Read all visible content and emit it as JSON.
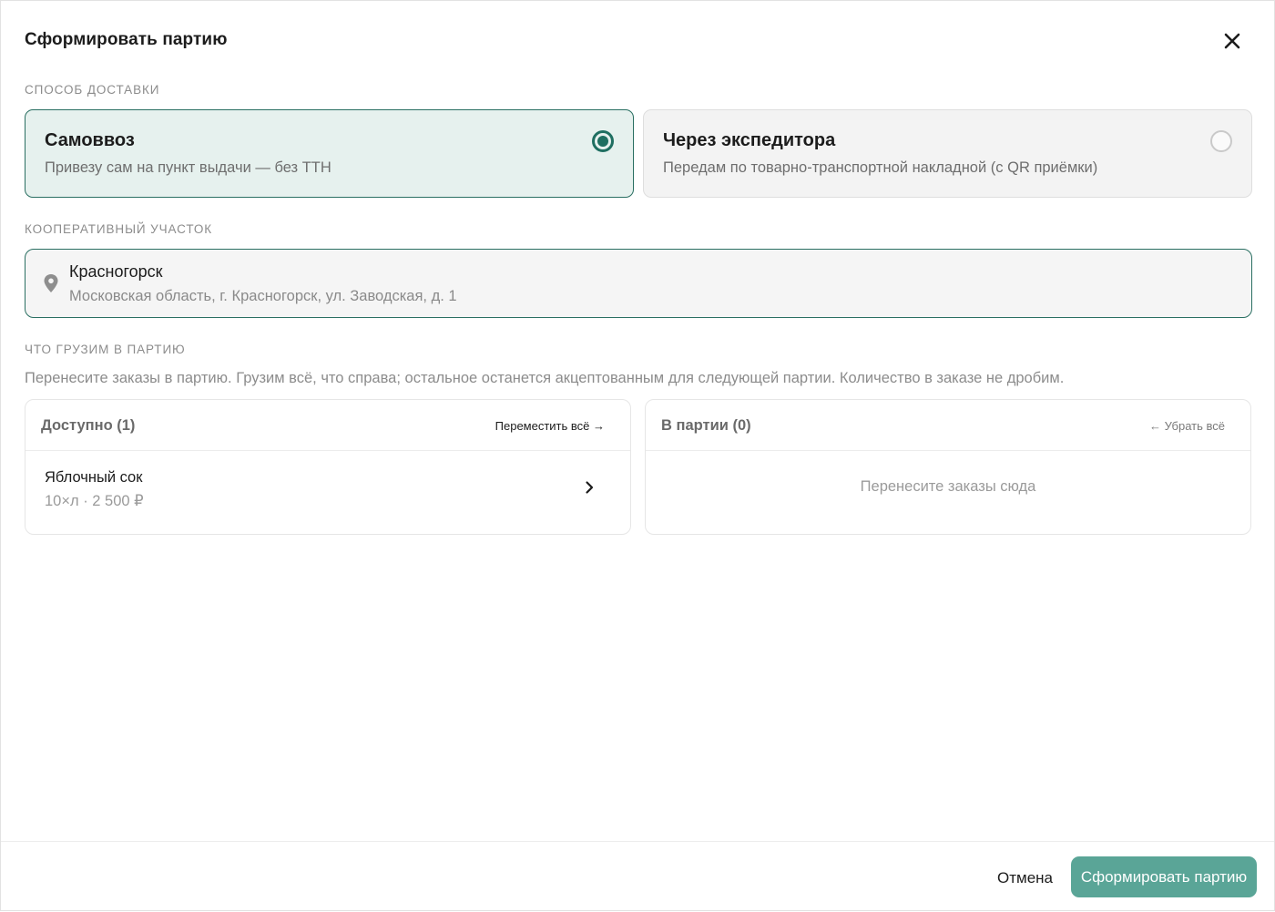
{
  "dialog": {
    "title": "Сформировать партию",
    "close_icon": "close-icon"
  },
  "delivery": {
    "label": "СПОСОБ ДОСТАВКИ",
    "options": [
      {
        "title": "Самоввоз",
        "description": "Привезу сам на пункт выдачи — без ТТН",
        "selected": true
      },
      {
        "title": "Через экспедитора",
        "description": "Передам по товарно-транспортной накладной (с QR приёмки)",
        "selected": false
      }
    ]
  },
  "site": {
    "label": "КООПЕРАТИВНЫЙ УЧАСТОК",
    "name": "Красногорск",
    "address": "Московская область, г. Красногорск, ул. Заводская, д. 1",
    "icon": "map-pin-icon"
  },
  "batch": {
    "label": "ЧТО ГРУЗИМ В ПАРТИЮ",
    "hint": "Перенесите заказы в партию. Грузим всё, что справа; остальное останется акцептованным для следующей партии. Количество в заказе не дробим.",
    "available": {
      "title": "Доступно (1)",
      "action": "Переместить всё →",
      "items": [
        {
          "name": "Яблочный сок",
          "meta": "10×л · 2 500 ₽",
          "icon": "chevron-right-icon"
        }
      ]
    },
    "in_batch": {
      "title": "В партии (0)",
      "action": "← Убрать всё",
      "empty_text": "Перенесите заказы сюда"
    }
  },
  "footer": {
    "cancel_label": "Отмена",
    "submit_label": "Сформировать партию"
  },
  "colors": {
    "accent": "#1f6f61",
    "selected_bg": "#e6f1ee",
    "submit_bg": "#5aa597"
  }
}
